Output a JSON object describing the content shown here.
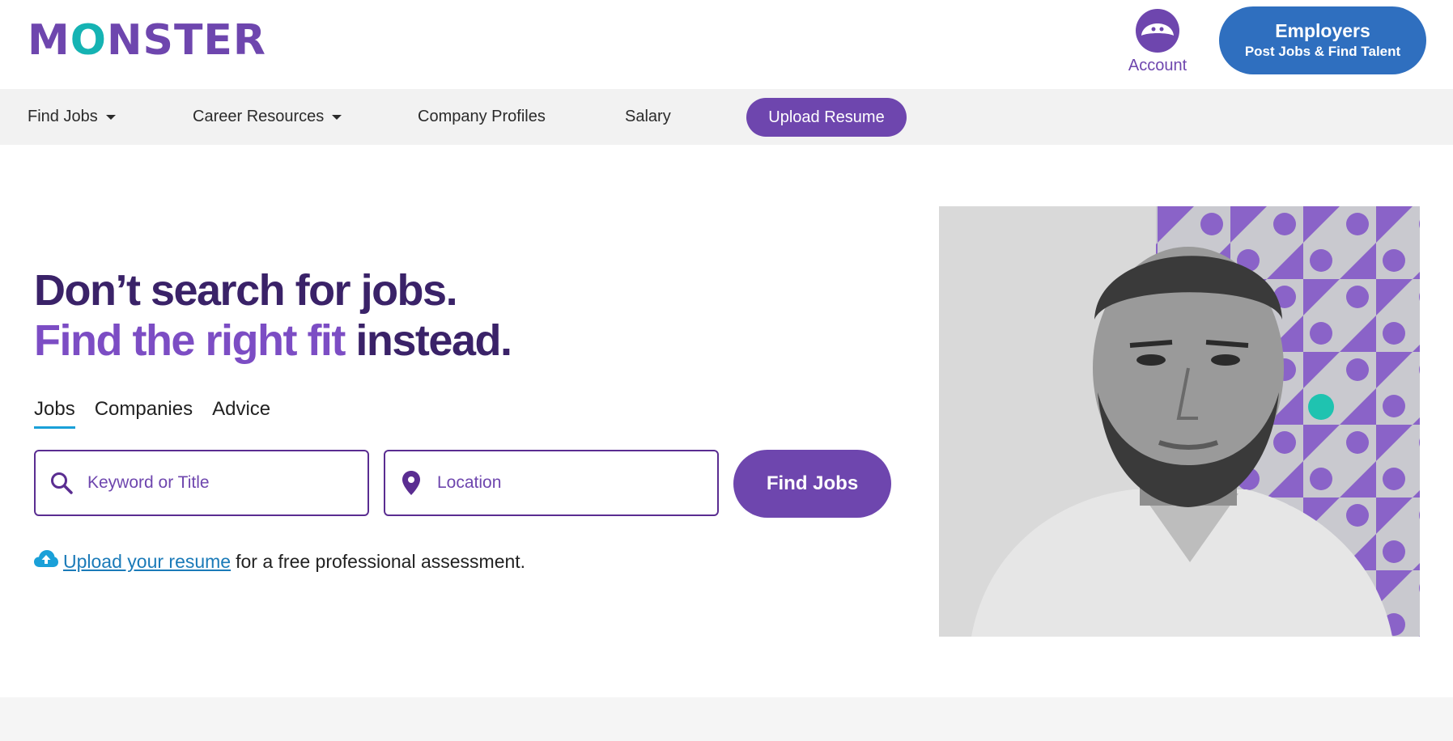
{
  "header": {
    "logo_left": "M",
    "logo_o": "O",
    "logo_right": "NSTER",
    "account_label": "Account",
    "employers_title": "Employers",
    "employers_subtitle": "Post Jobs & Find Talent"
  },
  "nav": {
    "items": [
      {
        "label": "Find Jobs"
      },
      {
        "label": "Career Resources"
      },
      {
        "label": "Company Profiles"
      },
      {
        "label": "Salary"
      }
    ],
    "upload_resume": "Upload Resume"
  },
  "hero": {
    "line1": "Don’t search for jobs.",
    "line2_accent": "Find the right fit",
    "line2_rest": " instead.",
    "tabs": [
      {
        "label": "Jobs",
        "active": true
      },
      {
        "label": "Companies"
      },
      {
        "label": "Advice"
      }
    ],
    "keyword_placeholder": "Keyword or Title",
    "location_placeholder": "Location",
    "find_button": "Find Jobs",
    "upload_link": "Upload your resume",
    "upload_rest": "for a free professional assessment."
  },
  "colors": {
    "brand_purple": "#6e46ae",
    "dark_purple": "#3a2268",
    "teal": "#15b3b3",
    "employer_blue": "#2f6fbf",
    "link_blue": "#1a7ab8"
  },
  "icons": {
    "account": "monster-face-icon",
    "search": "search-icon",
    "location": "map-pin-icon",
    "upload": "cloud-upload-icon"
  }
}
